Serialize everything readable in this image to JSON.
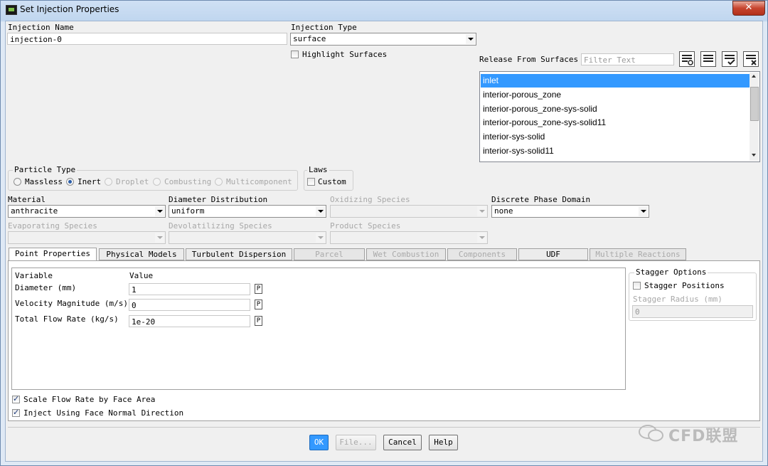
{
  "window": {
    "title": "Set Injection Properties",
    "close_label": "✕"
  },
  "injection_name": {
    "label": "Injection Name",
    "value": "injection-0"
  },
  "injection_type": {
    "label": "Injection Type",
    "value": "surface"
  },
  "highlight_surfaces": {
    "label": "Highlight Surfaces",
    "checked": false
  },
  "release_from_surfaces": {
    "label": "Release From Surfaces",
    "filter_placeholder": "Filter Text",
    "items": [
      "inlet",
      "interior-porous_zone",
      "interior-porous_zone-sys-solid",
      "interior-porous_zone-sys-solid11",
      "interior-sys-solid",
      "interior-sys-solid11"
    ],
    "selected": "inlet",
    "toolbar_icons": [
      "select-all-icon",
      "deselect-all-icon",
      "list-check-icon",
      "list-clear-icon"
    ]
  },
  "particle_type": {
    "label": "Particle Type",
    "options": [
      "Massless",
      "Inert",
      "Droplet",
      "Combusting",
      "Multicomponent"
    ],
    "selected": "Inert"
  },
  "laws": {
    "label": "Laws",
    "custom_label": "Custom",
    "custom_checked": false
  },
  "fields": {
    "material": {
      "label": "Material",
      "value": "anthracite"
    },
    "diameter_distribution": {
      "label": "Diameter Distribution",
      "value": "uniform"
    },
    "oxidizing_species": {
      "label": "Oxidizing Species",
      "value": ""
    },
    "discrete_phase_domain": {
      "label": "Discrete Phase Domain",
      "value": "none"
    },
    "evaporating_species": {
      "label": "Evaporating Species",
      "value": ""
    },
    "devolatilizing_species": {
      "label": "Devolatilizing Species",
      "value": ""
    },
    "product_species": {
      "label": "Product Species",
      "value": ""
    }
  },
  "tabs": [
    "Point Properties",
    "Physical Models",
    "Turbulent Dispersion",
    "Parcel",
    "Wet Combustion",
    "Components",
    "UDF",
    "Multiple Reactions"
  ],
  "point_properties": {
    "col_variable": "Variable",
    "col_value": "Value",
    "rows": [
      {
        "label": "Diameter (mm)",
        "value": "1"
      },
      {
        "label": "Velocity Magnitude (m/s)",
        "value": "0"
      },
      {
        "label": "Total Flow Rate (kg/s)",
        "value": "1e-20"
      }
    ],
    "param_label": "P"
  },
  "stagger": {
    "title": "Stagger Options",
    "positions_label": "Stagger Positions",
    "radius_label": "Stagger Radius (mm)",
    "radius_value": "0"
  },
  "scale_flow_rate": {
    "label": "Scale Flow Rate by Face Area",
    "checked": true
  },
  "inject_normal": {
    "label": "Inject Using Face Normal Direction",
    "checked": true
  },
  "buttons": {
    "ok": "OK",
    "file": "File...",
    "cancel": "Cancel",
    "help": "Help"
  },
  "watermark": "CFD联盟"
}
